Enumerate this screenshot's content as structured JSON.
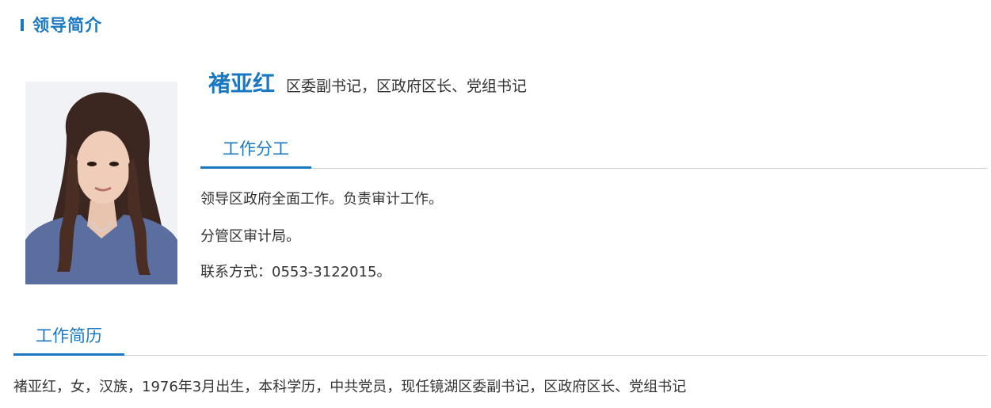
{
  "section": {
    "title": "领导简介"
  },
  "leader": {
    "name": "褚亚红",
    "position": "区委副书记，区政府区长、党组书记",
    "photo_alt": "photo"
  },
  "duties_tab": {
    "label": "工作分工"
  },
  "duties": [
    "领导区政府全面工作。负责审计工作。",
    "分管区审计局。",
    "联系方式：0553-3122015。"
  ],
  "resume_tab": {
    "label": "工作简历"
  },
  "resume": {
    "text": "褚亚红，女，汉族，1976年3月出生，本科学历，中共党员，现任镜湖区委副书记，区政府区长、党组书记"
  },
  "colors": {
    "accent": "#1a78c2",
    "text": "#333333",
    "divider": "#cfcfcf"
  }
}
